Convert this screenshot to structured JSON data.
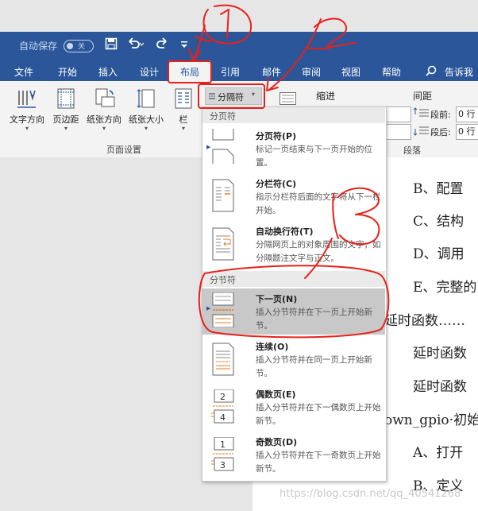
{
  "title_bar": {
    "autosave_label": "自动保存",
    "autosave_state": "关",
    "save_icon": "save-icon",
    "undo_icon": "undo-icon",
    "redo_icon": "redo-icon",
    "customize_icon": "customize-icon"
  },
  "menu": {
    "tabs": [
      "文件",
      "开始",
      "插入",
      "设计",
      "布局",
      "引用",
      "邮件",
      "审阅",
      "视图",
      "帮助"
    ],
    "active_tab": "布局",
    "tell_me": "告诉我"
  },
  "ribbon": {
    "buttons": [
      {
        "label": "文字方向",
        "icon": "text-direction-icon"
      },
      {
        "label": "页边距",
        "icon": "margins-icon"
      },
      {
        "label": "纸张方向",
        "icon": "orientation-icon"
      },
      {
        "label": "纸张大小",
        "icon": "size-icon"
      },
      {
        "label": "栏",
        "icon": "columns-icon"
      }
    ],
    "breaks_button": "分隔符",
    "group_page_setup": "页面设置",
    "indent_label": "缩进",
    "spacing_label": "间距",
    "spacing_before_label": "段前:",
    "spacing_before_value": "0 行",
    "spacing_after_label": "段后:",
    "spacing_after_value": "0 行",
    "group_paragraph": "段落"
  },
  "breaks_menu": {
    "page_breaks_header": "分页符",
    "page_breaks": [
      {
        "title": "分页符(P)",
        "desc": "标记一页结束与下一页开始的位置。"
      },
      {
        "title": "分栏符(C)",
        "desc": "指示分栏符后面的文字将从下一栏开始。"
      },
      {
        "title": "自动换行符(T)",
        "desc": "分隔网页上的对象周围的文字，如分隔题注文字与正文。"
      }
    ],
    "section_breaks_header": "分节符",
    "section_breaks": [
      {
        "title": "下一页(N)",
        "desc": "插入分节符并在下一页上开始新节。"
      },
      {
        "title": "连续(O)",
        "desc": "插入分节符并在同一页上开始新节。"
      },
      {
        "title": "偶数页(E)",
        "desc": "插入分节符并在下一偶数页上开始新节。"
      },
      {
        "title": "奇数页(D)",
        "desc": "插入分节符并在下一奇数页上开始新节。"
      }
    ],
    "selected_item": "下一页(N)"
  },
  "document": {
    "lines": [
      "B、配置",
      "C、结构",
      "D、调用",
      "E、完整的",
      "延时函数……",
      "延时函数",
      "延时函数",
      "own_gpio·初始",
      "A、打开",
      "B、定义"
    ]
  },
  "annotations": [
    "1",
    "2",
    "3"
  ],
  "watermark": "https://blog.csdn.net/qq_40541268"
}
